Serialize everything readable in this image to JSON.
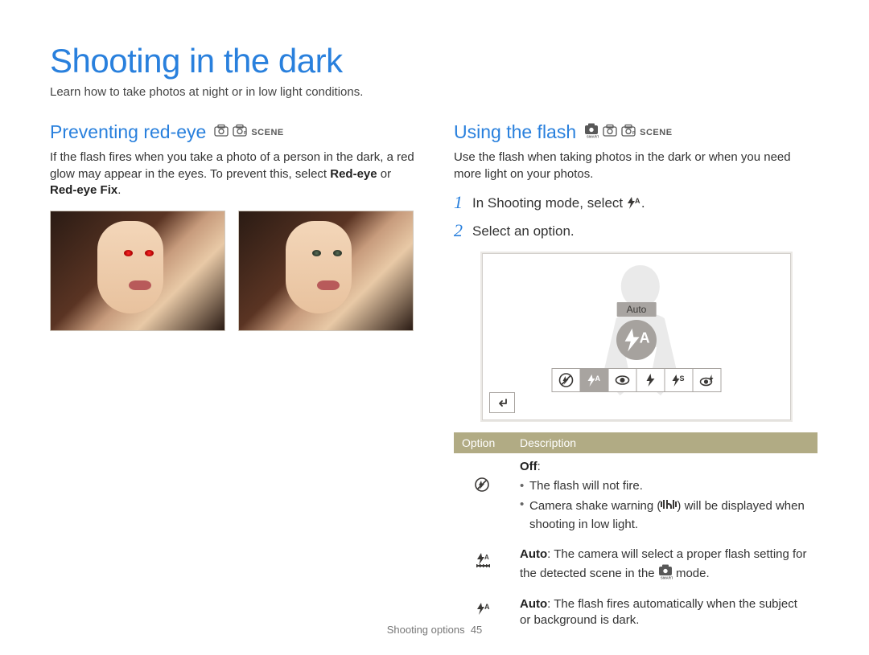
{
  "header": {
    "title": "Shooting in the dark",
    "subtitle": "Learn how to take photos at night or in low light conditions."
  },
  "left": {
    "heading": "Preventing red-eye",
    "mode_scene": "SCENE",
    "body_a": "If the flash fires when you take a photo of a person in the dark, a red glow may appear in the eyes. To prevent this, select ",
    "body_b": "Red-eye",
    "body_c": " or ",
    "body_d": "Red-eye Fix",
    "body_e": "."
  },
  "right": {
    "heading": "Using the flash",
    "mode_scene": "SCENE",
    "intro": "Use the flash when taking photos in the dark or when you need more light on your photos.",
    "step1_a": "In Shooting mode, select ",
    "step1_b": ".",
    "step2": "Select an option.",
    "flash_auto_label": "Auto",
    "table": {
      "header_option": "Option",
      "header_desc": "Description",
      "row_off_name": "Off",
      "row_off_colon": ":",
      "row_off_b1": "The flash will not fire.",
      "row_off_b2a": "Camera shake warning (",
      "row_off_b2b": ") will be displayed when shooting in low light.",
      "row_auto_smart_name": "Auto",
      "row_auto_smart_a": ": The camera will select a proper flash setting for the detected scene in the ",
      "row_auto_smart_b": " mode.",
      "row_auto_name": "Auto",
      "row_auto_desc": ": The flash fires automatically when the subject or background is dark."
    }
  },
  "footer": {
    "section": "Shooting options",
    "page": "45"
  }
}
